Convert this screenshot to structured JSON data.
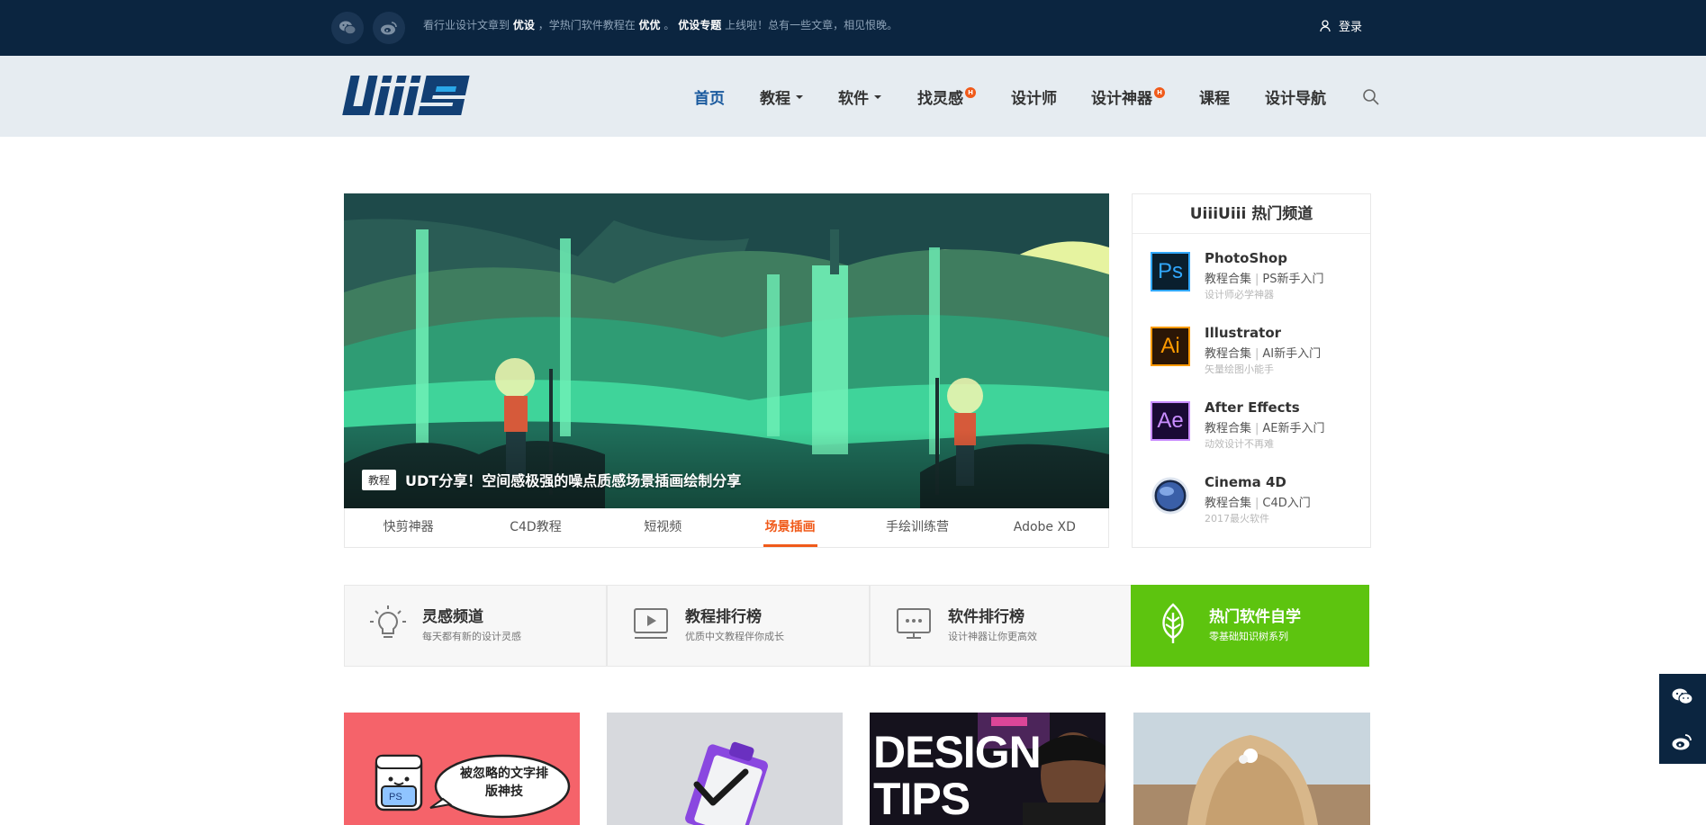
{
  "topbar": {
    "notice_part1": "看行业设计文章到",
    "notice_b1": "优设",
    "notice_part2": "，学热门软件教程在",
    "notice_b2": "优优",
    "notice_part3": "。",
    "notice_b3": "优设专题",
    "notice_part4": "上线啦！总有一些文章，相见恨晚。",
    "login_label": "登录"
  },
  "nav": {
    "items": [
      {
        "label": "首页"
      },
      {
        "label": "教程"
      },
      {
        "label": "软件"
      },
      {
        "label": "找灵感",
        "badge": "H"
      },
      {
        "label": "设计师"
      },
      {
        "label": "设计神器",
        "badge": "H"
      },
      {
        "label": "课程"
      },
      {
        "label": "设计导航"
      }
    ]
  },
  "hero": {
    "tag": "教程",
    "title": "UDT分享！空间感极强的噪点质感场景插画绘制分享",
    "tabs": [
      "快剪神器",
      "C4D教程",
      "短视频",
      "场景插画",
      "手绘训练营",
      "Adobe XD"
    ]
  },
  "sidebar": {
    "title": "UiiiUiii 热门频道",
    "software": [
      {
        "name": "PhotoShop",
        "link1": "教程合集",
        "link2": "PS新手入门",
        "desc": "设计师必学神器",
        "icon_text": "Ps"
      },
      {
        "name": "Illustrator",
        "link1": "教程合集",
        "link2": "AI新手入门",
        "desc": "矢量绘图小能手",
        "icon_text": "Ai"
      },
      {
        "name": "After Effects",
        "link1": "教程合集",
        "link2": "AE新手入门",
        "desc": "动效设计不再难",
        "icon_text": "Ae"
      },
      {
        "name": "Cinema 4D",
        "link1": "教程合集",
        "link2": "C4D入门",
        "desc": "2017最火软件"
      }
    ]
  },
  "features": [
    {
      "title": "灵感频道",
      "sub": "每天都有新的设计灵感"
    },
    {
      "title": "教程排行榜",
      "sub": "优质中文教程伴你成长"
    },
    {
      "title": "软件排行榜",
      "sub": "设计神器让你更高效"
    },
    {
      "title": "热门软件自学",
      "sub": "零基础知识树系列"
    }
  ],
  "thumbs": {
    "t1_text": "被忽略的文字排版神技",
    "t1_badge": "PS",
    "t3_text1": "DESIGN",
    "t3_text2": "TIPS"
  },
  "colors": {
    "topbar": "#0b2540",
    "nav_bg": "#e6ecf1",
    "accent_orange": "#f05a1a",
    "accent_green": "#5dc40f",
    "nav_active": "#1a5a9e"
  }
}
